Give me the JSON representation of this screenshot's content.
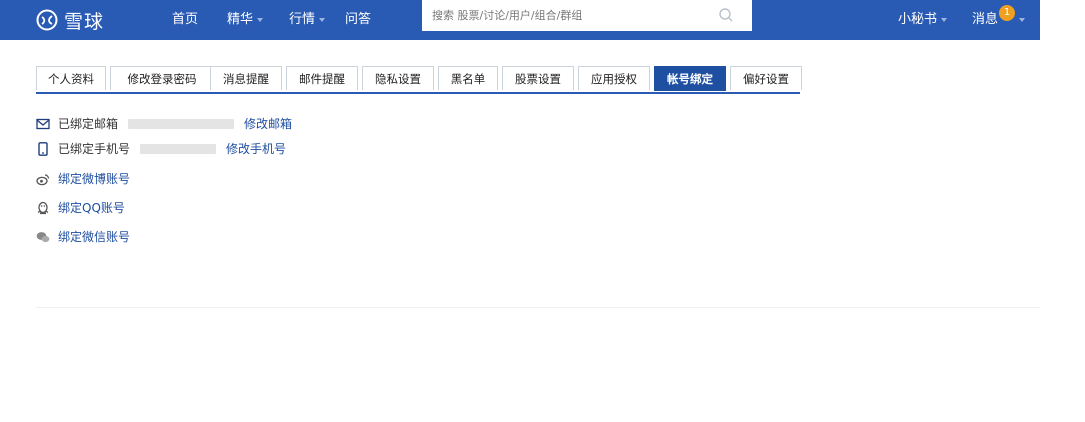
{
  "header": {
    "logo_text": "雪球",
    "nav": [
      "首页",
      "精华",
      "行情",
      "问答"
    ],
    "search_placeholder": "搜索 股票/讨论/用户/组合/群组",
    "user_label": "小秘书",
    "messages_label": "消息",
    "messages_count": "1"
  },
  "tabs": {
    "items": [
      "个人资料",
      "修改登录密码",
      "消息提醒",
      "邮件提醒",
      "隐私设置",
      "黑名单",
      "股票设置",
      "应用授权",
      "帐号绑定",
      "偏好设置"
    ],
    "active": "帐号绑定"
  },
  "bindings": {
    "email_label": "已绑定邮箱",
    "email_action": "修改邮箱",
    "phone_label": "已绑定手机号",
    "phone_action": "修改手机号",
    "weibo": "绑定微博账号",
    "qq": "绑定QQ账号",
    "wechat": "绑定微信账号"
  },
  "colors": {
    "header_bg": "#2a5bb4",
    "active_tab": "#1f4fa0",
    "link": "#1f4fa0",
    "badge": "#f0a020"
  },
  "icons": {
    "logo": "snowball-logo-icon",
    "search": "search-icon",
    "email": "envelope-icon",
    "phone": "mobile-phone-icon",
    "weibo": "weibo-icon",
    "qq": "qq-penguin-icon",
    "wechat": "wechat-icon"
  }
}
